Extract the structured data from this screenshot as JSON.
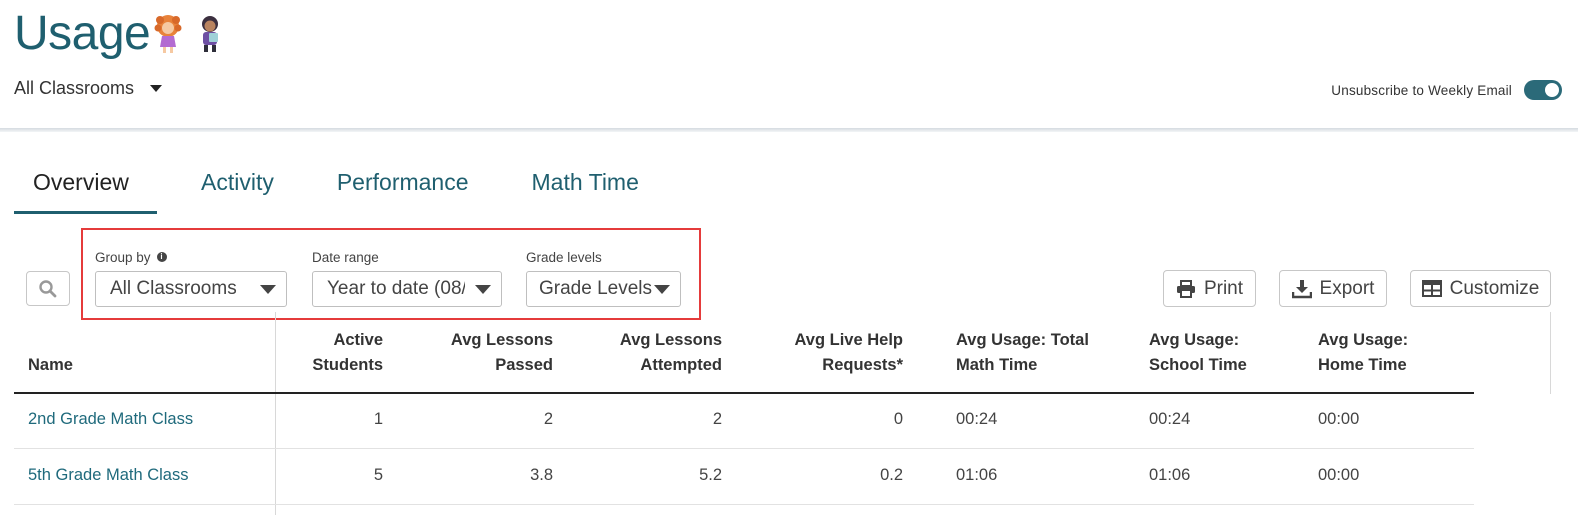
{
  "header": {
    "title": "Usage",
    "classroom_selector": "All Classrooms",
    "unsubscribe_label": "Unsubscribe to Weekly Email",
    "unsubscribe_on": true
  },
  "tabs": [
    {
      "label": "Overview",
      "active": true
    },
    {
      "label": "Activity",
      "active": false
    },
    {
      "label": "Performance",
      "active": false
    },
    {
      "label": "Math Time",
      "active": false
    }
  ],
  "filters": {
    "group_by": {
      "label": "Group by",
      "value": "All Classrooms"
    },
    "date_range": {
      "label": "Date range",
      "value": "Year to date (08/"
    },
    "grade_levels": {
      "label": "Grade levels",
      "value": "Grade Levels"
    }
  },
  "actions": {
    "print": "Print",
    "export": "Export",
    "customize": "Customize"
  },
  "table": {
    "columns": [
      {
        "line1": "",
        "line2": "Name"
      },
      {
        "line1": "Active",
        "line2": "Students"
      },
      {
        "line1": "Avg Lessons",
        "line2": "Passed"
      },
      {
        "line1": "Avg Lessons",
        "line2": "Attempted"
      },
      {
        "line1": "Avg Live Help",
        "line2": "Requests*"
      },
      {
        "line1": "Avg Usage: Total",
        "line2": "Math Time"
      },
      {
        "line1": "Avg Usage:",
        "line2": "School Time"
      },
      {
        "line1": "Avg Usage:",
        "line2": "Home Time"
      }
    ],
    "rows": [
      [
        "2nd Grade Math Class",
        "1",
        "2",
        "2",
        "0",
        "00:24",
        "00:24",
        "00:00"
      ],
      [
        "5th Grade Math Class",
        "5",
        "3.8",
        "5.2",
        "0.2",
        "01:06",
        "01:06",
        "00:00"
      ]
    ]
  },
  "colors": {
    "brand": "#1f5f6f",
    "link": "#1f6a7c",
    "highlight_border": "#e53b3b",
    "toggle_on": "#2b6a79"
  }
}
